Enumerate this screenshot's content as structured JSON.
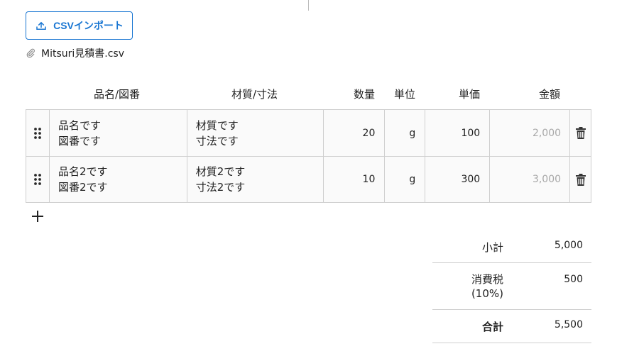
{
  "toolbar": {
    "import_label": "CSVインポート"
  },
  "attachment": {
    "filename": "Mitsuri見積書.csv"
  },
  "table": {
    "headers": {
      "name": "品名/図番",
      "material": "材質/寸法",
      "qty": "数量",
      "unit": "単位",
      "price": "単価",
      "amount": "金額"
    },
    "rows": [
      {
        "name": "品名です",
        "drawing": "図番です",
        "material": "材質です",
        "size": "寸法です",
        "qty": "20",
        "unit": "g",
        "price": "100",
        "amount": "2,000"
      },
      {
        "name": "品名2です",
        "drawing": "図番2です",
        "material": "材質2です",
        "size": "寸法2です",
        "qty": "10",
        "unit": "g",
        "price": "300",
        "amount": "3,000"
      }
    ]
  },
  "summary": {
    "subtotal_label": "小計",
    "subtotal": "5,000",
    "tax_label_line1": "消費税",
    "tax_label_line2": "(10%)",
    "tax": "500",
    "total_label": "合計",
    "total": "5,500"
  },
  "icons": {
    "upload": "upload-icon",
    "paperclip": "paperclip-icon",
    "drag": "drag-handle-icon",
    "delete": "trash-icon",
    "add": "plus-icon"
  },
  "colors": {
    "accent": "#1976d2",
    "border": "#cfcfcf",
    "muted": "#a8a8a8",
    "row_bg": "#fafafa"
  }
}
